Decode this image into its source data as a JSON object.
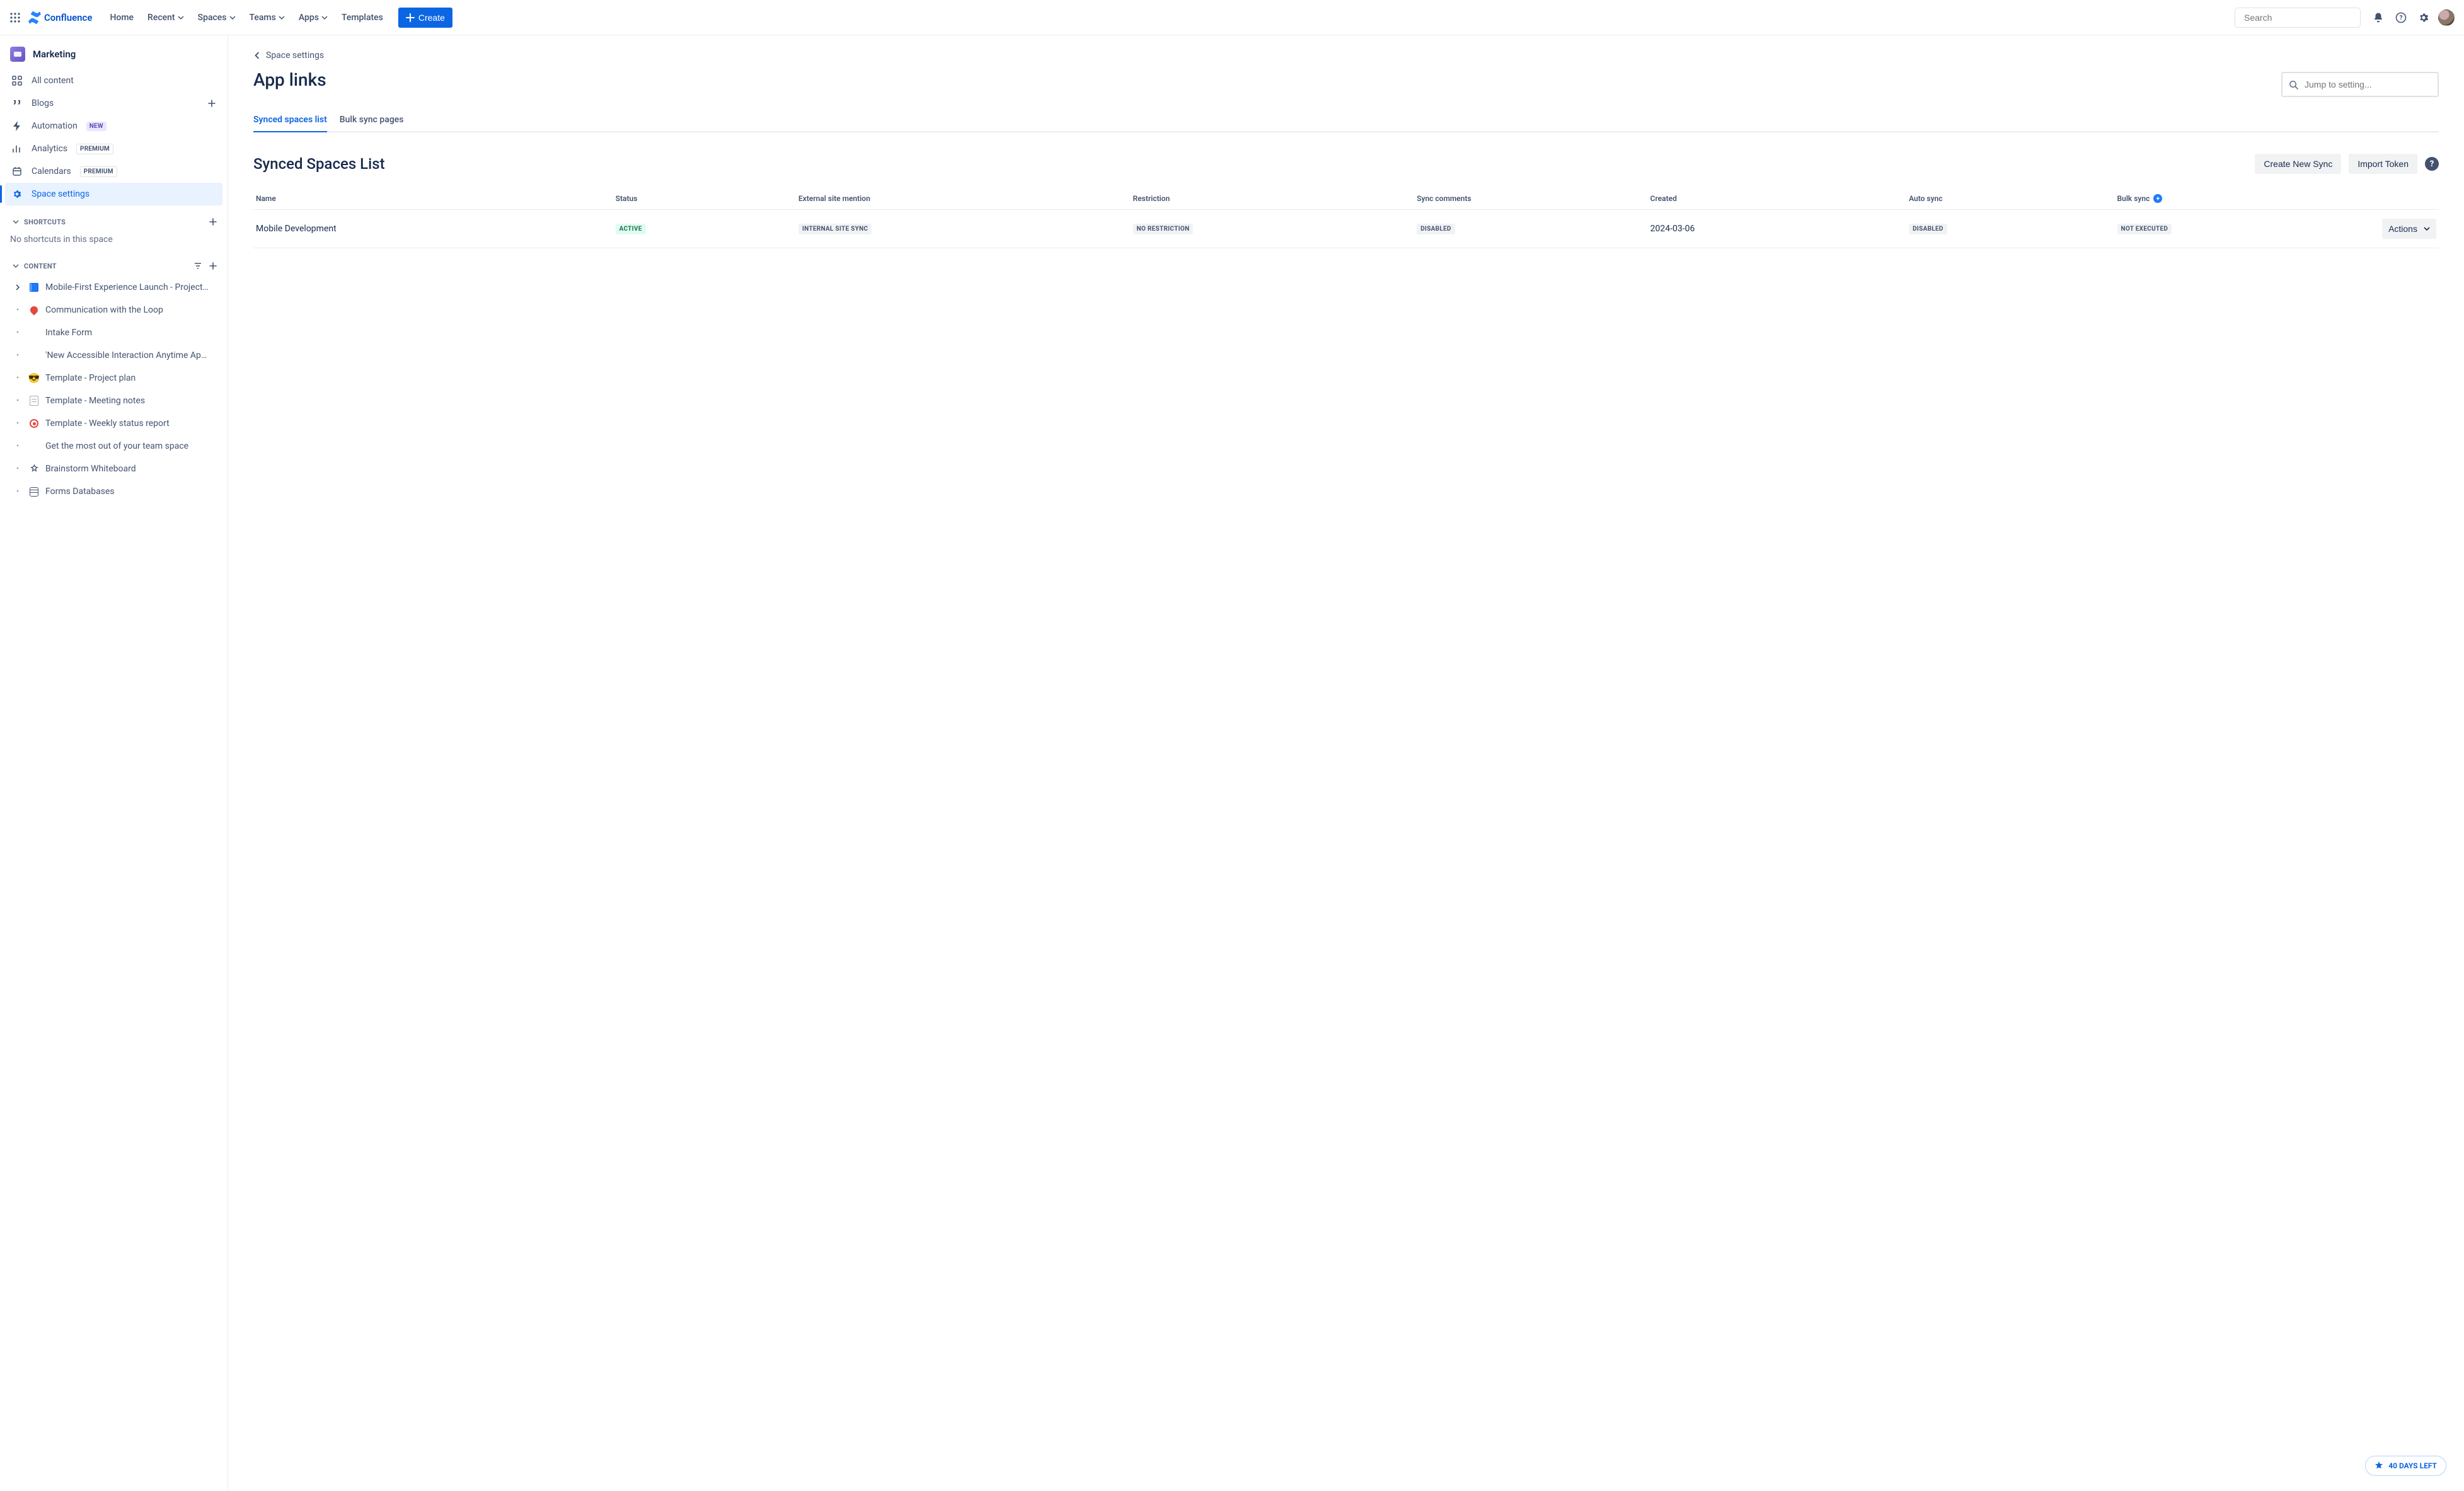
{
  "header": {
    "product": "Confluence",
    "nav": {
      "home": "Home",
      "recent": "Recent",
      "spaces": "Spaces",
      "teams": "Teams",
      "apps": "Apps",
      "templates": "Templates"
    },
    "create": "Create",
    "search_placeholder": "Search"
  },
  "sidebar": {
    "space": "Marketing",
    "items": {
      "all_content": "All content",
      "blogs": "Blogs",
      "automation": "Automation",
      "automation_badge": "NEW",
      "analytics": "Analytics",
      "analytics_badge": "PREMIUM",
      "calendars": "Calendars",
      "calendars_badge": "PREMIUM",
      "space_settings": "Space settings"
    },
    "sections": {
      "shortcuts": "SHORTCUTS",
      "shortcuts_empty": "No shortcuts in this space",
      "content": "CONTENT"
    },
    "content_tree": [
      {
        "icon": "blue",
        "label": "Mobile-First Experience Launch - Project C…",
        "expandable": true
      },
      {
        "icon": "pin",
        "label": "Communication with the Loop"
      },
      {
        "icon": "",
        "label": "Intake Form"
      },
      {
        "icon": "",
        "label": "'New Accessible Interaction Anytime App' mark…"
      },
      {
        "icon": "cool",
        "label": "Template - Project plan"
      },
      {
        "icon": "note",
        "label": "Template - Meeting notes"
      },
      {
        "icon": "target",
        "label": "Template - Weekly status report"
      },
      {
        "icon": "",
        "label": "Get the most out of your team space"
      },
      {
        "icon": "spark",
        "label": "Brainstorm Whiteboard"
      },
      {
        "icon": "db",
        "label": "Forms Databases"
      }
    ]
  },
  "main": {
    "breadcrumb": "Space settings",
    "title": "App links",
    "jump_placeholder": "Jump to setting...",
    "tabs": {
      "synced": "Synced spaces list",
      "bulk": "Bulk sync pages"
    },
    "section_title": "Synced Spaces List",
    "buttons": {
      "create": "Create New Sync",
      "import": "Import Token",
      "actions": "Actions"
    },
    "columns": {
      "name": "Name",
      "status": "Status",
      "mention": "External site mention",
      "restriction": "Restriction",
      "comments": "Sync comments",
      "created": "Created",
      "auto": "Auto sync",
      "bulk": "Bulk sync"
    },
    "row": {
      "name": "Mobile Development",
      "status": "ACTIVE",
      "mention": "INTERNAL SITE SYNC",
      "restriction": "NO RESTRICTION",
      "comments": "DISABLED",
      "created": "2024-03-06",
      "auto": "DISABLED",
      "bulk": "NOT EXECUTED"
    }
  },
  "footer": {
    "days_left": "40 DAYS LEFT"
  }
}
